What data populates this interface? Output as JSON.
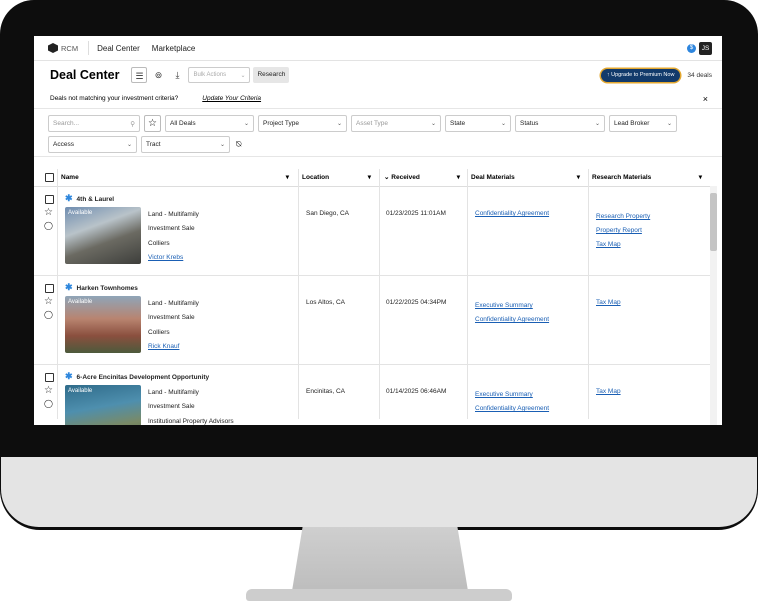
{
  "nav": {
    "logo": "RCM",
    "links": [
      "Deal Center",
      "Marketplace"
    ],
    "coin": "$",
    "user_initials": "JS"
  },
  "header": {
    "title": "Deal Center",
    "list_icon": "list-icon",
    "map_icon": "map-pin-icon",
    "download_icon": "download-icon",
    "bulk_actions": "Bulk Actions",
    "research": "Research",
    "upgrade": "↑ Upgrade to Premium Now",
    "deal_count": "34 deals"
  },
  "criteria": {
    "message": "Deals not matching your investment criteria?",
    "link": "Update Your Criteria",
    "close": "×"
  },
  "filters": {
    "search_placeholder": "Search...",
    "all_deals": "All Deals",
    "project_type": "Project Type",
    "asset_type": "Asset Type",
    "state": "State",
    "status": "Status",
    "lead_broker": "Lead Broker",
    "access": "Access",
    "tract": "Tract"
  },
  "columns": [
    "Name",
    "Location",
    "Received",
    "Deal Materials",
    "Research Materials"
  ],
  "deals": [
    {
      "name": "4th & Laurel",
      "status": "Available",
      "type": "Land - Multifamily",
      "sale": "Investment Sale",
      "broker": "Colliers",
      "agent": "Victor Krebs",
      "location": "San Diego, CA",
      "received": "01/23/2025 11:01AM",
      "deal_materials": [
        "Confidentiality Agreement"
      ],
      "research_materials": [
        "Research Property",
        "Property Report",
        "Tax Map"
      ]
    },
    {
      "name": "Harken Townhomes",
      "status": "Available",
      "type": "Land - Multifamily",
      "sale": "Investment Sale",
      "broker": "Colliers",
      "agent": "Rick Knauf",
      "location": "Los Altos, CA",
      "received": "01/22/2025 04:34PM",
      "deal_materials": [
        "Executive Summary",
        "Confidentiality Agreement"
      ],
      "research_materials": [
        "Tax Map"
      ]
    },
    {
      "name": "6-Acre Encinitas Development Opportunity",
      "status": "Available",
      "type": "Land - Multifamily",
      "sale": "Investment Sale",
      "broker": "Institutional Property Advisors",
      "location": "Encinitas, CA",
      "received": "01/14/2025 06:46AM",
      "deal_materials": [
        "Executive Summary",
        "Confidentiality Agreement"
      ],
      "research_materials": [
        "Tax Map"
      ]
    }
  ]
}
